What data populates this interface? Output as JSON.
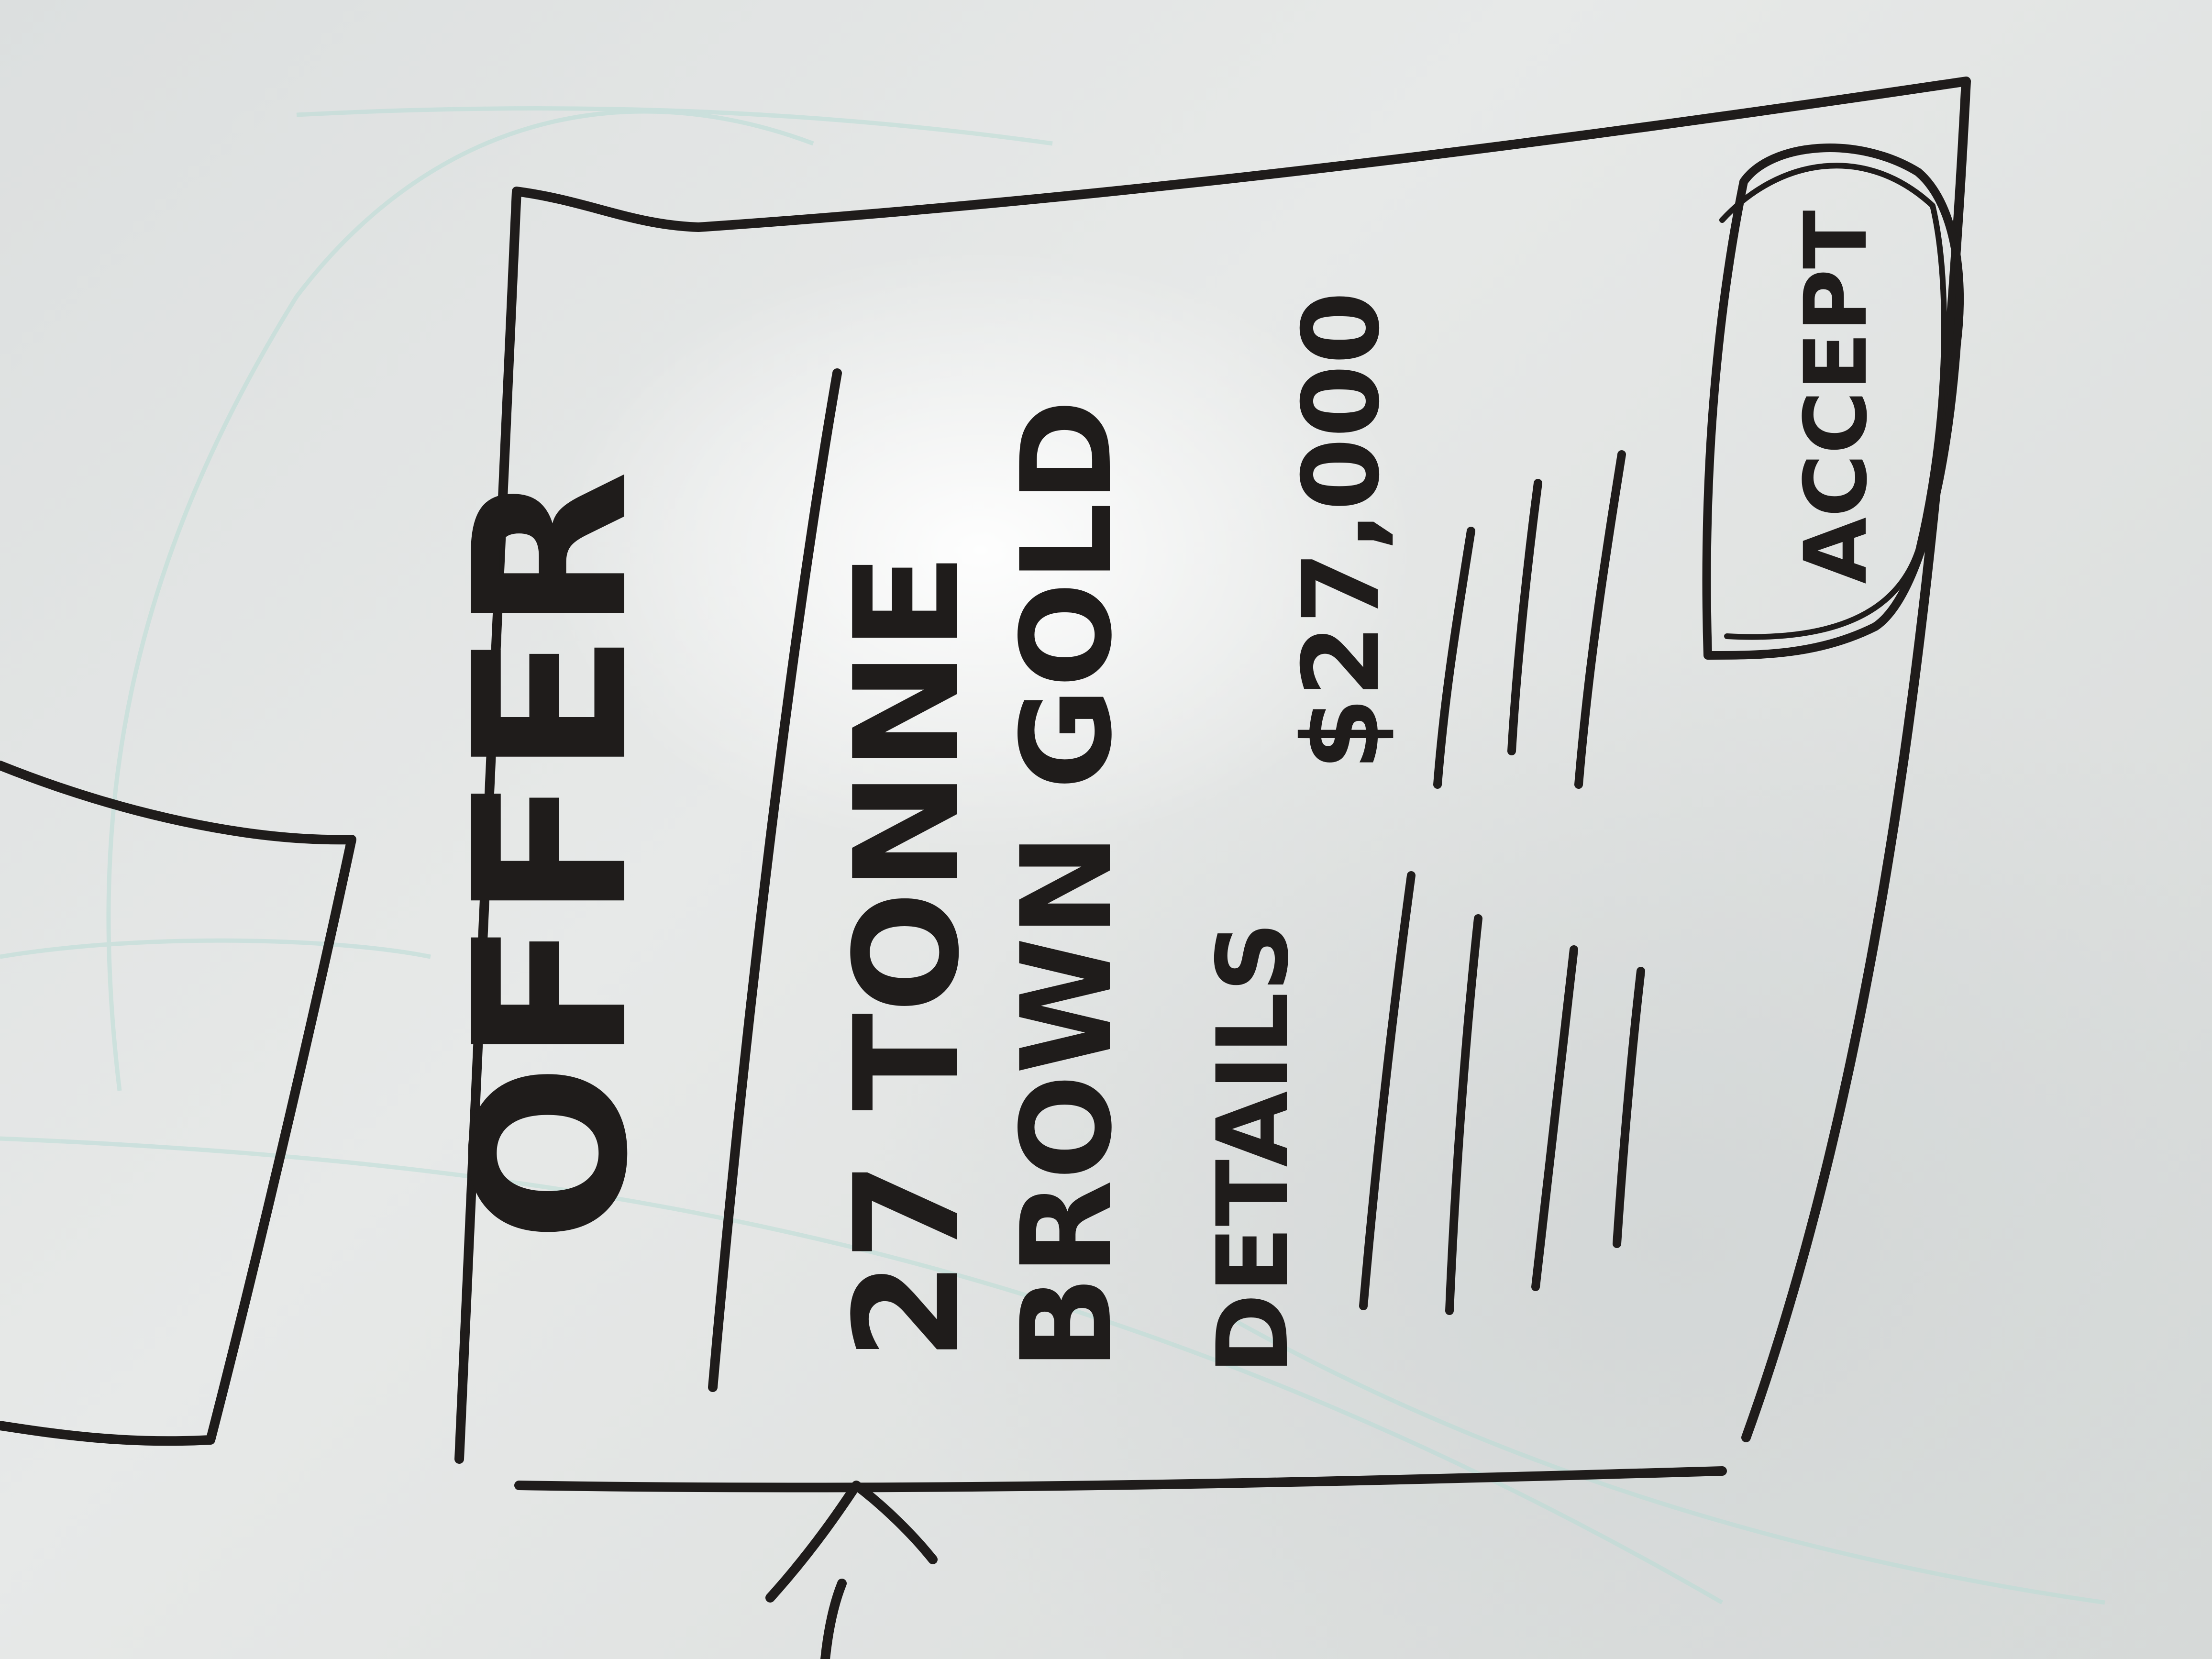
{
  "sketch": {
    "title": "OFFER",
    "product_line": "27 TONNE",
    "product_desc": "BROWN GOLD",
    "details_label": "DETAILS",
    "price": "$27,000",
    "accept_label": "ACCEPT"
  },
  "colors": {
    "ink": "#1f1c1b",
    "board": "#e4e6e5"
  }
}
